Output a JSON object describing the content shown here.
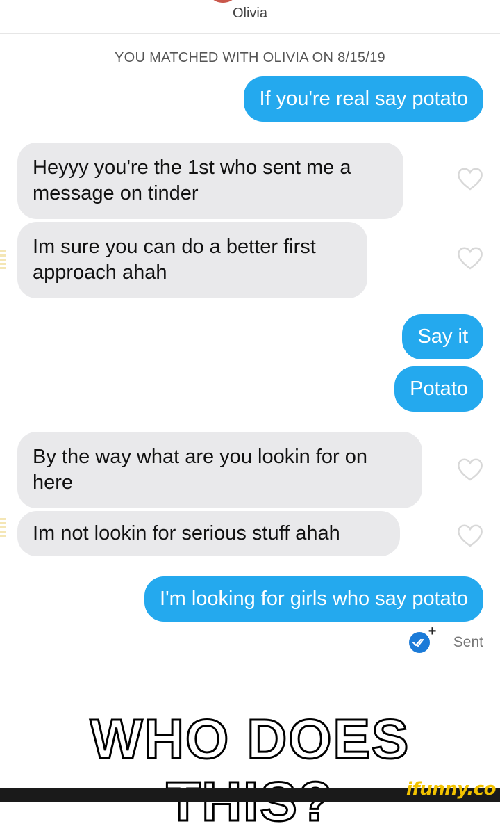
{
  "header": {
    "contact_name": "Olivia"
  },
  "match_banner": "YOU MATCHED WITH OLIVIA ON 8/15/19",
  "messages": [
    {
      "from": "me",
      "text": "If you're real say potato"
    },
    {
      "from": "them",
      "text": "Heyyy you're the 1st who sent me a message on tinder"
    },
    {
      "from": "them",
      "text": "Im sure you can do a better first approach ahah"
    },
    {
      "from": "me",
      "text": "Say it"
    },
    {
      "from": "me",
      "text": "Potato"
    },
    {
      "from": "them",
      "text": "By the way what are you lookin for on here"
    },
    {
      "from": "them",
      "text": "Im not lookin for serious stuff ahah"
    },
    {
      "from": "me",
      "text": "I'm looking for girls who say potato"
    }
  ],
  "status": {
    "icon": "double-check-icon",
    "plus": "+",
    "label": "Sent"
  },
  "caption": "WHO DOES THIS?",
  "watermark": "ifunny.co",
  "colors": {
    "outgoing": "#24a9ee",
    "incoming": "#e9e9eb",
    "watermark": "#f2c200"
  }
}
